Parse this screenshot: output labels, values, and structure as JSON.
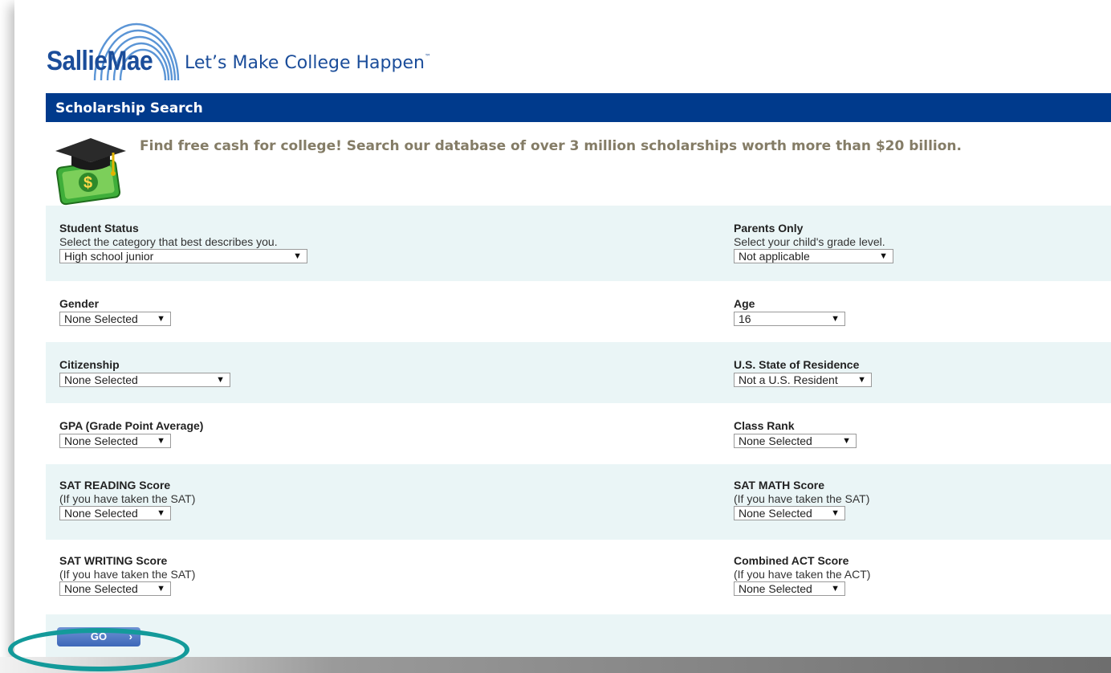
{
  "header": {
    "logo_text": "SallieMae",
    "tagline": "Let’s Make College Happen",
    "tagline_mark": "™"
  },
  "title_bar": {
    "title": "Scholarship Search"
  },
  "promo": {
    "text": "Find free cash for college! Search our database of over 3 million scholarships worth more than $20 billion."
  },
  "form": {
    "student_status": {
      "label": "Student Status",
      "sublabel": "Select the category that best describes you.",
      "value": "High school junior"
    },
    "parents_only": {
      "label": "Parents Only",
      "sublabel": "Select your child's grade level.",
      "value": "Not applicable"
    },
    "gender": {
      "label": "Gender",
      "value": "None Selected"
    },
    "age": {
      "label": "Age",
      "value": "16"
    },
    "citizenship": {
      "label": "Citizenship",
      "value": "None Selected"
    },
    "state": {
      "label": "U.S. State of Residence",
      "value": "Not a U.S. Resident"
    },
    "gpa": {
      "label": "GPA (Grade Point Average)",
      "value": "None Selected"
    },
    "class_rank": {
      "label": "Class Rank",
      "value": "None Selected"
    },
    "sat_reading": {
      "label": "SAT READING Score",
      "sublabel": "(If you have taken the SAT)",
      "value": "None Selected"
    },
    "sat_math": {
      "label": "SAT MATH Score",
      "sublabel": "(If you have taken the SAT)",
      "value": "None Selected"
    },
    "sat_writing": {
      "label": "SAT WRITING Score",
      "sublabel": "(If you have taken the SAT)",
      "value": "None Selected"
    },
    "act": {
      "label": "Combined ACT Score",
      "sublabel": "(If you have taken the ACT)",
      "value": "None Selected"
    },
    "dropdown_arrow": "▼"
  },
  "go_button": {
    "label": "GO",
    "chevron": "›"
  },
  "colors": {
    "brand_blue": "#1b4d9a",
    "title_bar": "#003a8c",
    "row_alt": "#eaf5f6",
    "promo_text": "#847c66",
    "highlight_ring": "#139a9a"
  },
  "icons": {
    "promo": "graduation-cap-money-icon",
    "logo": "salliemae-arcs-icon"
  }
}
